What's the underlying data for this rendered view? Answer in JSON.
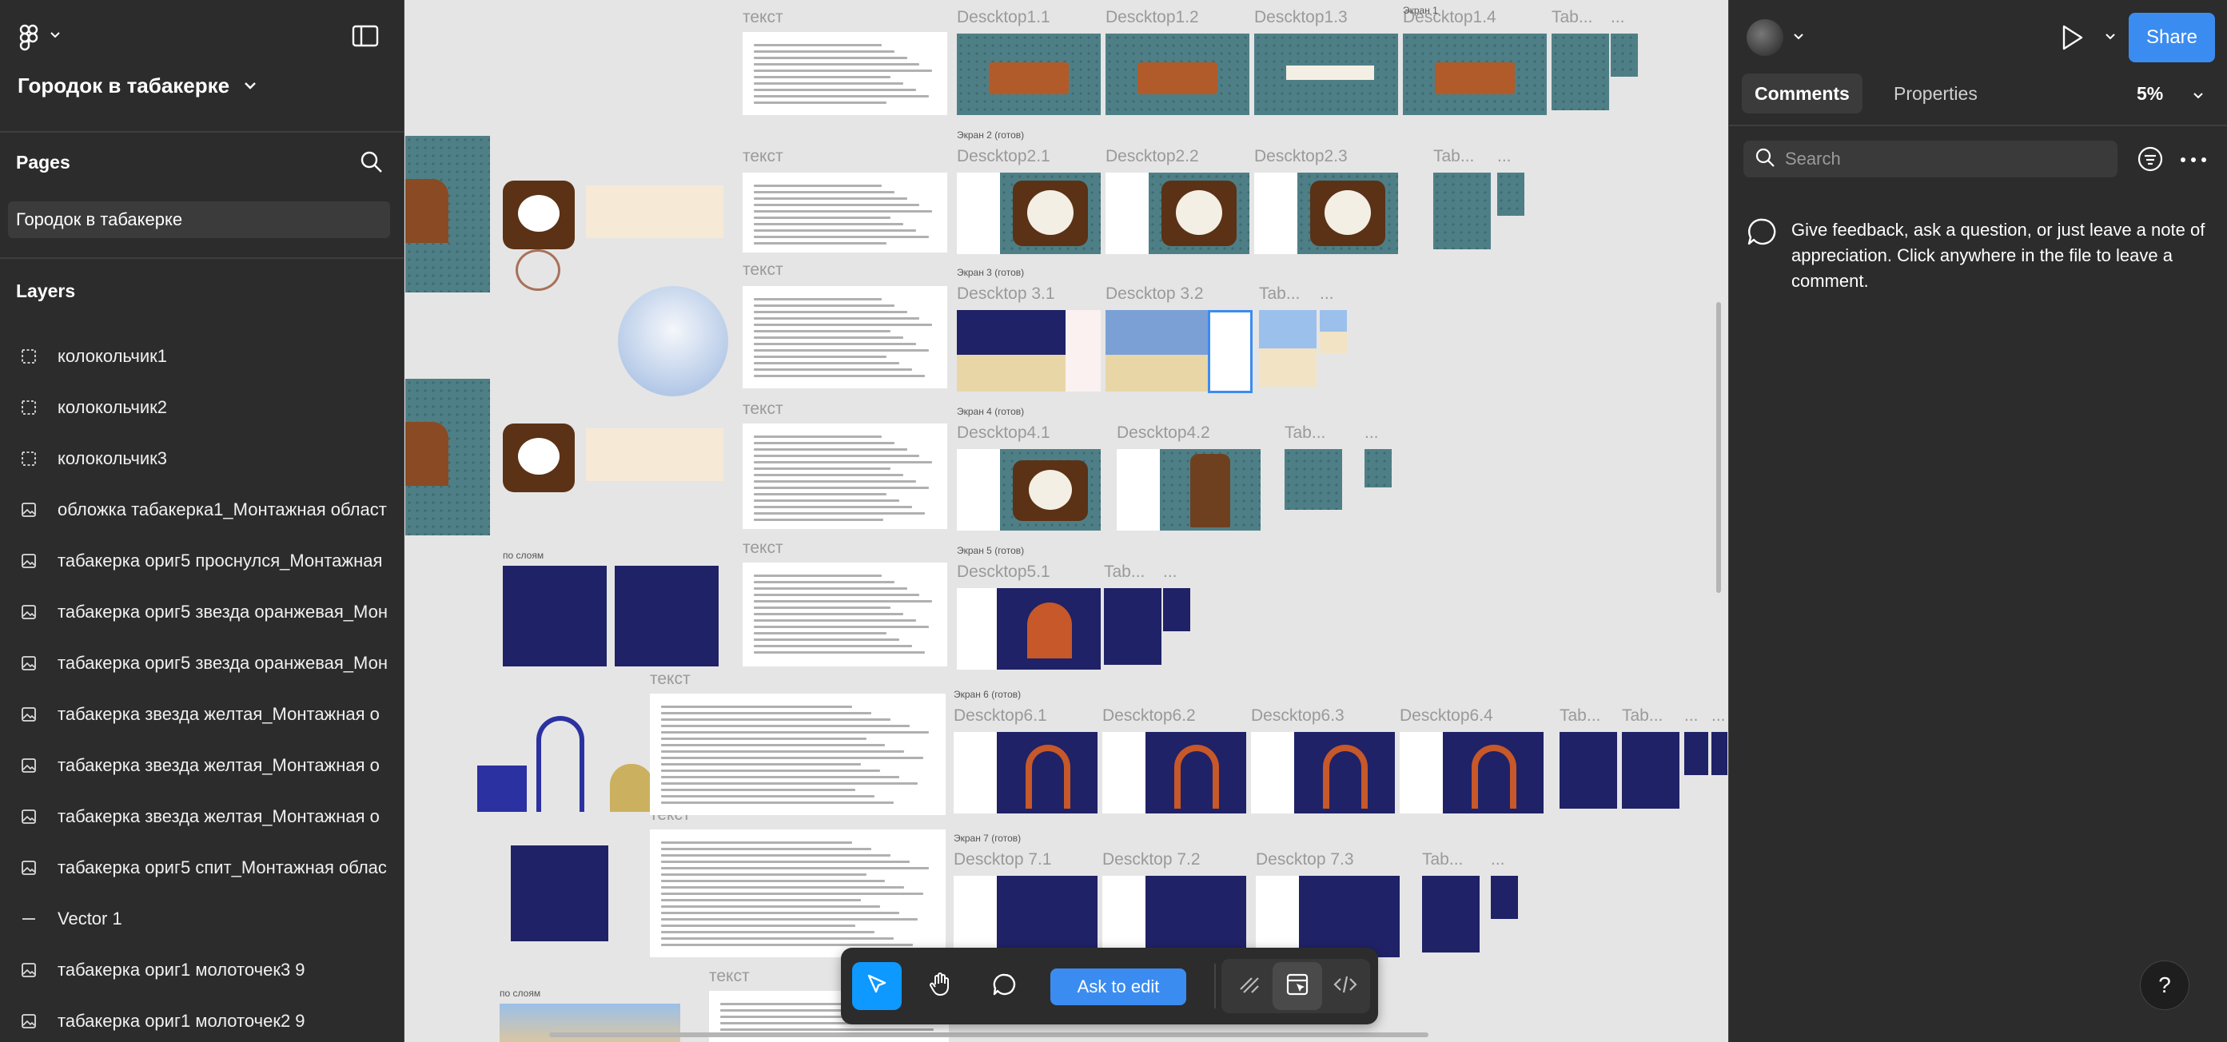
{
  "file": {
    "title": "Городок в табакерке"
  },
  "pages": {
    "header": "Pages",
    "items": [
      {
        "label": "Городок в табакерке"
      }
    ]
  },
  "layers": {
    "header": "Layers",
    "items": [
      {
        "label": "колокольчик1",
        "icon": "frame-dashed-icon"
      },
      {
        "label": "колокольчик2",
        "icon": "frame-dashed-icon"
      },
      {
        "label": "колокольчик3",
        "icon": "frame-dashed-icon"
      },
      {
        "label": "обложка табакерка1_Монтажная област",
        "icon": "image-icon"
      },
      {
        "label": "табакерка ориг5 проснулся_Монтажная",
        "icon": "image-icon"
      },
      {
        "label": "табакерка ориг5 звезда оранжевая_Мон",
        "icon": "image-icon"
      },
      {
        "label": "табакерка ориг5 звезда оранжевая_Мон",
        "icon": "image-icon"
      },
      {
        "label": "табакерка  звезда желтая_Монтажная о",
        "icon": "image-icon"
      },
      {
        "label": "табакерка  звезда желтая_Монтажная о",
        "icon": "image-icon"
      },
      {
        "label": "табакерка  звезда желтая_Монтажная о",
        "icon": "image-icon"
      },
      {
        "label": "табакерка ориг5 спит_Монтажная облас",
        "icon": "image-icon"
      },
      {
        "label": "Vector 1",
        "icon": "line-icon"
      },
      {
        "label": "табакерка ориг1 молоточек3 9",
        "icon": "image-icon"
      },
      {
        "label": "табакерка ориг1 молоточек2 9",
        "icon": "image-icon"
      }
    ]
  },
  "canvas": {
    "text_label": "текст",
    "by_layers_label": "по слоям",
    "row1": {
      "frames": [
        "Desсktop1.1",
        "Desсktop1.2",
        "Desсktop1.3",
        "Desсktop1.4",
        "Tab...",
        "..."
      ],
      "screen": "Экран 1"
    },
    "row2": {
      "screen": "Экран 2 (готов)",
      "frames": [
        "Desсktop2.1",
        "Desсktop2.2",
        "Desсktop2.3",
        "Tab...",
        "..."
      ]
    },
    "row3": {
      "screen": "Экран 3 (готов)",
      "frames": [
        "Desсktop 3.1",
        "Desсktop 3.2",
        "Tab...",
        "..."
      ]
    },
    "row4": {
      "screen": "Экран 4 (готов)",
      "frames": [
        "Desсktop4.1",
        "Desсktop4.2",
        "Tab...",
        "..."
      ]
    },
    "row5": {
      "screen": "Экран 5 (готов)",
      "frames": [
        "Desсktop5.1",
        "Tab...",
        "..."
      ]
    },
    "row6": {
      "screen": "Экран 6 (готов)",
      "frames": [
        "Desсktop6.1",
        "Desсktop6.2",
        "Desсktop6.3",
        "Desсktop6.4",
        "Tab...",
        "Tab...",
        "...",
        "..."
      ]
    },
    "row7": {
      "screen": "Экран 7 (готов)",
      "frames": [
        "Desсktop 7.1",
        "Desсktop 7.2",
        "Desсktop 7.3",
        "Tab...",
        "..."
      ]
    }
  },
  "toolbar": {
    "ask_edit_label": "Ask to edit"
  },
  "right_panel": {
    "share_label": "Share",
    "tabs": [
      "Comments",
      "Properties"
    ],
    "zoom": "5%",
    "search_placeholder": "Search",
    "hint": "Give feedback, ask a question, or just leave a note of appreciation. Click anywhere in the file to leave a comment.",
    "help_label": "?"
  },
  "colors": {
    "accent": "#0d99ff",
    "share": "#3b8cf0",
    "panel": "#2c2c2c",
    "canvas": "#e5e5e5"
  }
}
